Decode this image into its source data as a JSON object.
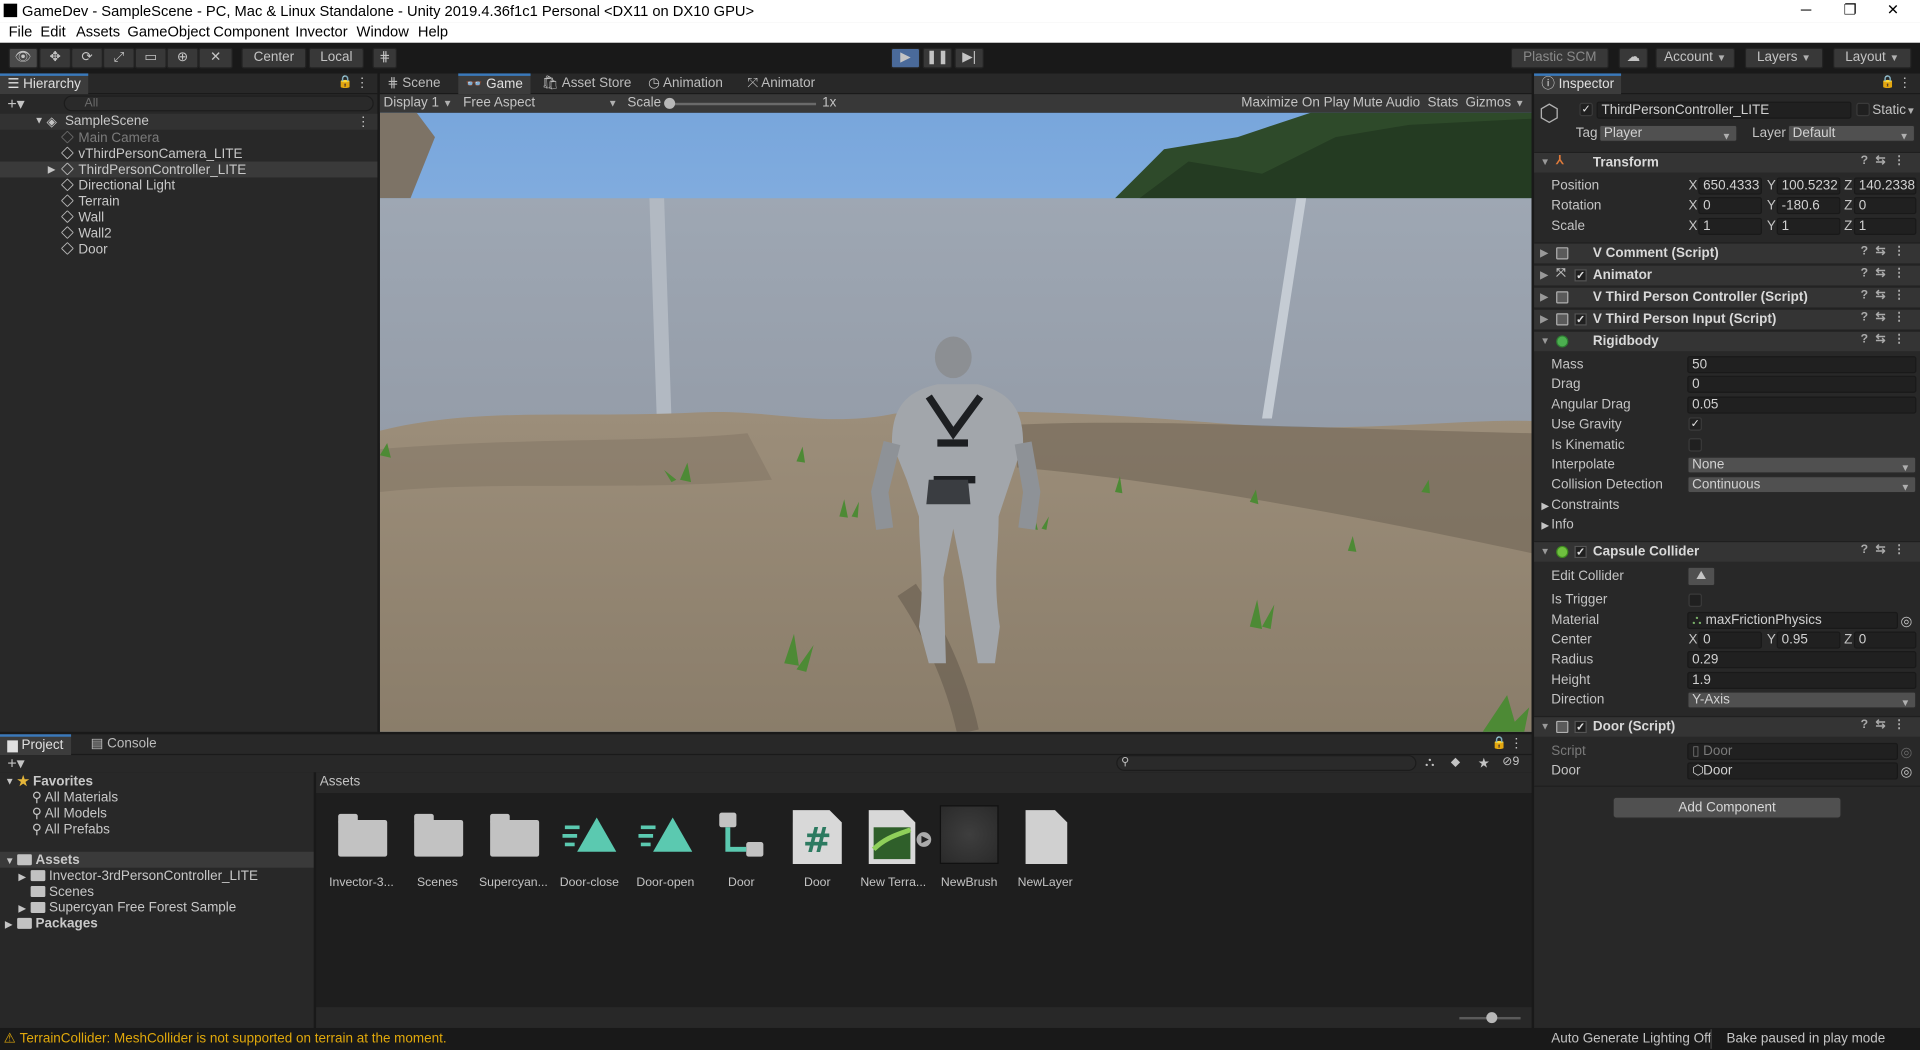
{
  "window": {
    "title": "GameDev - SampleScene - PC, Mac & Linux Standalone - Unity 2019.4.36f1c1 Personal <DX11 on DX10 GPU>",
    "minimize": "─",
    "maximize": "❐",
    "close": "✕"
  },
  "menu": [
    "File",
    "Edit",
    "Assets",
    "GameObject",
    "Component",
    "Invector",
    "Window",
    "Help"
  ],
  "toolbar": {
    "center": "Center",
    "local": "Local",
    "plastic": "Plastic SCM",
    "account": "Account",
    "layers": "Layers",
    "layout": "Layout"
  },
  "hierarchy": {
    "tab": "Hierarchy",
    "search_placeholder": "All",
    "scene": "SampleScene",
    "items": [
      "Main Camera",
      "vThirdPersonCamera_LITE",
      "ThirdPersonController_LITE",
      "Directional Light",
      "Terrain",
      "Wall",
      "Wall2",
      "Door"
    ]
  },
  "game": {
    "tabs": [
      "Scene",
      "Game",
      "Asset Store",
      "Animation",
      "Animator"
    ],
    "display": "Display 1",
    "aspect": "Free Aspect",
    "scale_label": "Scale",
    "scale_value": "1x",
    "scale_level": 0,
    "buttons": [
      "Maximize On Play",
      "Mute Audio",
      "Stats",
      "Gizmos"
    ]
  },
  "inspector": {
    "tab": "Inspector",
    "object": "ThirdPersonController_LITE",
    "static": "Static",
    "tag_label": "Tag",
    "tag": "Player",
    "layer_label": "Layer",
    "layer": "Default",
    "transform": {
      "name": "Transform",
      "position_label": "Position",
      "rotation_label": "Rotation",
      "scale_label": "Scale",
      "position": [
        "650.4333",
        "100.5232",
        "140.2338"
      ],
      "rotation": [
        "0",
        "-180.6",
        "0"
      ],
      "scale": [
        "1",
        "1",
        "1"
      ]
    },
    "components": [
      "V Comment (Script)",
      "Animator",
      "V Third Person Controller (Script)",
      "V Third Person Input (Script)"
    ],
    "rigidbody": {
      "name": "Rigidbody",
      "mass_label": "Mass",
      "mass": "50",
      "drag_label": "Drag",
      "drag": "0",
      "angular_label": "Angular Drag",
      "angular": "0.05",
      "gravity_label": "Use Gravity",
      "gravity": "✓",
      "kinematic_label": "Is Kinematic",
      "interp_label": "Interpolate",
      "interp": "None",
      "coll_label": "Collision Detection",
      "coll": "Continuous",
      "constraints": "Constraints",
      "info": "Info"
    },
    "capsule": {
      "name": "Capsule Collider",
      "edit_label": "Edit Collider",
      "trigger_label": "Is Trigger",
      "material_label": "Material",
      "material": "maxFrictionPhysics",
      "center_label": "Center",
      "center": [
        "0",
        "0.95",
        "0"
      ],
      "radius_label": "Radius",
      "radius": "0.29",
      "height_label": "Height",
      "height": "1.9",
      "direction_label": "Direction",
      "direction": "Y-Axis"
    },
    "door": {
      "name": "Door (Script)",
      "script_label": "Script",
      "script": "Door",
      "door_label": "Door",
      "door": "Door"
    },
    "add_component": "Add Component",
    "axes": [
      "X",
      "Y",
      "Z"
    ]
  },
  "project": {
    "tabs": [
      "Project",
      "Console"
    ],
    "favorites": "Favorites",
    "fav_items": [
      "All Materials",
      "All Models",
      "All Prefabs"
    ],
    "assets": "Assets",
    "asset_folders": [
      "Invector-3rdPersonController_LITE",
      "Scenes",
      "Supercyan Free Forest Sample"
    ],
    "packages": "Packages",
    "hidden_count": "9",
    "grid_title": "Assets",
    "grid": [
      "Invector-3...",
      "Scenes",
      "Supercyan...",
      "Door-close",
      "Door-open",
      "Door",
      "Door",
      "New Terra...",
      "NewBrush",
      "NewLayer"
    ]
  },
  "status": {
    "warning": "TerrainCollider: MeshCollider is not supported on terrain at the moment.",
    "lighting": "Auto Generate Lighting Off",
    "bake": "Bake paused in play mode"
  },
  "colors": {
    "accent": "#3a79bb",
    "warning": "#e0a80b",
    "sky": "#9fc2e6"
  }
}
